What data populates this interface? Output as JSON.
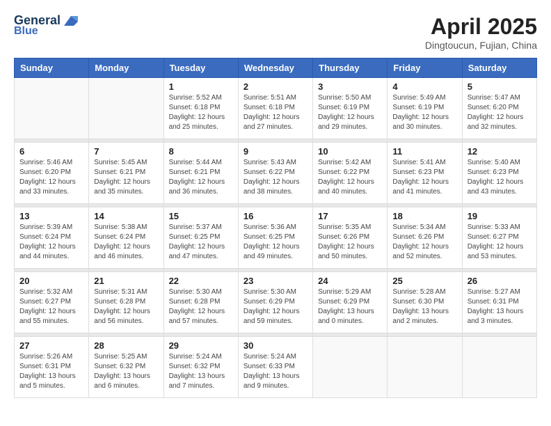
{
  "logo": {
    "line1": "General",
    "line2": "Blue"
  },
  "title": "April 2025",
  "subtitle": "Dingtoucun, Fujian, China",
  "headers": [
    "Sunday",
    "Monday",
    "Tuesday",
    "Wednesday",
    "Thursday",
    "Friday",
    "Saturday"
  ],
  "weeks": [
    [
      {
        "day": "",
        "sunrise": "",
        "sunset": "",
        "daylight": ""
      },
      {
        "day": "",
        "sunrise": "",
        "sunset": "",
        "daylight": ""
      },
      {
        "day": "1",
        "sunrise": "Sunrise: 5:52 AM",
        "sunset": "Sunset: 6:18 PM",
        "daylight": "Daylight: 12 hours and 25 minutes."
      },
      {
        "day": "2",
        "sunrise": "Sunrise: 5:51 AM",
        "sunset": "Sunset: 6:18 PM",
        "daylight": "Daylight: 12 hours and 27 minutes."
      },
      {
        "day": "3",
        "sunrise": "Sunrise: 5:50 AM",
        "sunset": "Sunset: 6:19 PM",
        "daylight": "Daylight: 12 hours and 29 minutes."
      },
      {
        "day": "4",
        "sunrise": "Sunrise: 5:49 AM",
        "sunset": "Sunset: 6:19 PM",
        "daylight": "Daylight: 12 hours and 30 minutes."
      },
      {
        "day": "5",
        "sunrise": "Sunrise: 5:47 AM",
        "sunset": "Sunset: 6:20 PM",
        "daylight": "Daylight: 12 hours and 32 minutes."
      }
    ],
    [
      {
        "day": "6",
        "sunrise": "Sunrise: 5:46 AM",
        "sunset": "Sunset: 6:20 PM",
        "daylight": "Daylight: 12 hours and 33 minutes."
      },
      {
        "day": "7",
        "sunrise": "Sunrise: 5:45 AM",
        "sunset": "Sunset: 6:21 PM",
        "daylight": "Daylight: 12 hours and 35 minutes."
      },
      {
        "day": "8",
        "sunrise": "Sunrise: 5:44 AM",
        "sunset": "Sunset: 6:21 PM",
        "daylight": "Daylight: 12 hours and 36 minutes."
      },
      {
        "day": "9",
        "sunrise": "Sunrise: 5:43 AM",
        "sunset": "Sunset: 6:22 PM",
        "daylight": "Daylight: 12 hours and 38 minutes."
      },
      {
        "day": "10",
        "sunrise": "Sunrise: 5:42 AM",
        "sunset": "Sunset: 6:22 PM",
        "daylight": "Daylight: 12 hours and 40 minutes."
      },
      {
        "day": "11",
        "sunrise": "Sunrise: 5:41 AM",
        "sunset": "Sunset: 6:23 PM",
        "daylight": "Daylight: 12 hours and 41 minutes."
      },
      {
        "day": "12",
        "sunrise": "Sunrise: 5:40 AM",
        "sunset": "Sunset: 6:23 PM",
        "daylight": "Daylight: 12 hours and 43 minutes."
      }
    ],
    [
      {
        "day": "13",
        "sunrise": "Sunrise: 5:39 AM",
        "sunset": "Sunset: 6:24 PM",
        "daylight": "Daylight: 12 hours and 44 minutes."
      },
      {
        "day": "14",
        "sunrise": "Sunrise: 5:38 AM",
        "sunset": "Sunset: 6:24 PM",
        "daylight": "Daylight: 12 hours and 46 minutes."
      },
      {
        "day": "15",
        "sunrise": "Sunrise: 5:37 AM",
        "sunset": "Sunset: 6:25 PM",
        "daylight": "Daylight: 12 hours and 47 minutes."
      },
      {
        "day": "16",
        "sunrise": "Sunrise: 5:36 AM",
        "sunset": "Sunset: 6:25 PM",
        "daylight": "Daylight: 12 hours and 49 minutes."
      },
      {
        "day": "17",
        "sunrise": "Sunrise: 5:35 AM",
        "sunset": "Sunset: 6:26 PM",
        "daylight": "Daylight: 12 hours and 50 minutes."
      },
      {
        "day": "18",
        "sunrise": "Sunrise: 5:34 AM",
        "sunset": "Sunset: 6:26 PM",
        "daylight": "Daylight: 12 hours and 52 minutes."
      },
      {
        "day": "19",
        "sunrise": "Sunrise: 5:33 AM",
        "sunset": "Sunset: 6:27 PM",
        "daylight": "Daylight: 12 hours and 53 minutes."
      }
    ],
    [
      {
        "day": "20",
        "sunrise": "Sunrise: 5:32 AM",
        "sunset": "Sunset: 6:27 PM",
        "daylight": "Daylight: 12 hours and 55 minutes."
      },
      {
        "day": "21",
        "sunrise": "Sunrise: 5:31 AM",
        "sunset": "Sunset: 6:28 PM",
        "daylight": "Daylight: 12 hours and 56 minutes."
      },
      {
        "day": "22",
        "sunrise": "Sunrise: 5:30 AM",
        "sunset": "Sunset: 6:28 PM",
        "daylight": "Daylight: 12 hours and 57 minutes."
      },
      {
        "day": "23",
        "sunrise": "Sunrise: 5:30 AM",
        "sunset": "Sunset: 6:29 PM",
        "daylight": "Daylight: 12 hours and 59 minutes."
      },
      {
        "day": "24",
        "sunrise": "Sunrise: 5:29 AM",
        "sunset": "Sunset: 6:29 PM",
        "daylight": "Daylight: 13 hours and 0 minutes."
      },
      {
        "day": "25",
        "sunrise": "Sunrise: 5:28 AM",
        "sunset": "Sunset: 6:30 PM",
        "daylight": "Daylight: 13 hours and 2 minutes."
      },
      {
        "day": "26",
        "sunrise": "Sunrise: 5:27 AM",
        "sunset": "Sunset: 6:31 PM",
        "daylight": "Daylight: 13 hours and 3 minutes."
      }
    ],
    [
      {
        "day": "27",
        "sunrise": "Sunrise: 5:26 AM",
        "sunset": "Sunset: 6:31 PM",
        "daylight": "Daylight: 13 hours and 5 minutes."
      },
      {
        "day": "28",
        "sunrise": "Sunrise: 5:25 AM",
        "sunset": "Sunset: 6:32 PM",
        "daylight": "Daylight: 13 hours and 6 minutes."
      },
      {
        "day": "29",
        "sunrise": "Sunrise: 5:24 AM",
        "sunset": "Sunset: 6:32 PM",
        "daylight": "Daylight: 13 hours and 7 minutes."
      },
      {
        "day": "30",
        "sunrise": "Sunrise: 5:24 AM",
        "sunset": "Sunset: 6:33 PM",
        "daylight": "Daylight: 13 hours and 9 minutes."
      },
      {
        "day": "",
        "sunrise": "",
        "sunset": "",
        "daylight": ""
      },
      {
        "day": "",
        "sunrise": "",
        "sunset": "",
        "daylight": ""
      },
      {
        "day": "",
        "sunrise": "",
        "sunset": "",
        "daylight": ""
      }
    ]
  ]
}
